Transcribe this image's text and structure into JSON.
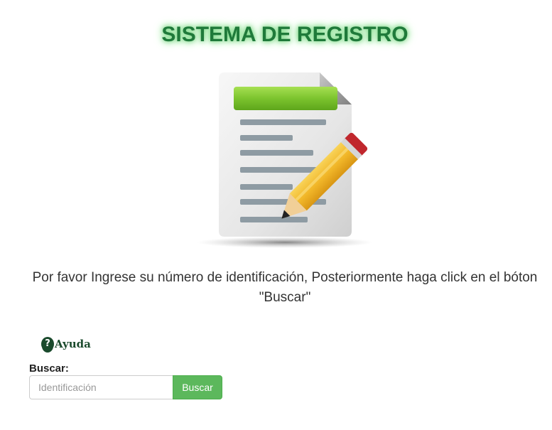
{
  "header": {
    "title": "SISTEMA DE REGISTRO"
  },
  "illustration": {
    "icon": "document-with-pencil-icon"
  },
  "instructions": {
    "text": "Por favor Ingrese su número de identificación, Posteriormente haga click en el bóton \"Buscar\""
  },
  "help": {
    "icon": "question-circle-icon",
    "label": "Ayuda"
  },
  "search": {
    "label": "Buscar:",
    "input_value": "",
    "placeholder": "Identificación",
    "button_label": "Buscar"
  },
  "colors": {
    "title": "#1f7a3a",
    "title_glow": "#8fe39a",
    "help": "#1a4a2c",
    "button_bg": "#5cb85c",
    "header_bar_green": "#7cc42e",
    "pencil_body": "#f2b82a",
    "pencil_eraser": "#c0272d"
  }
}
